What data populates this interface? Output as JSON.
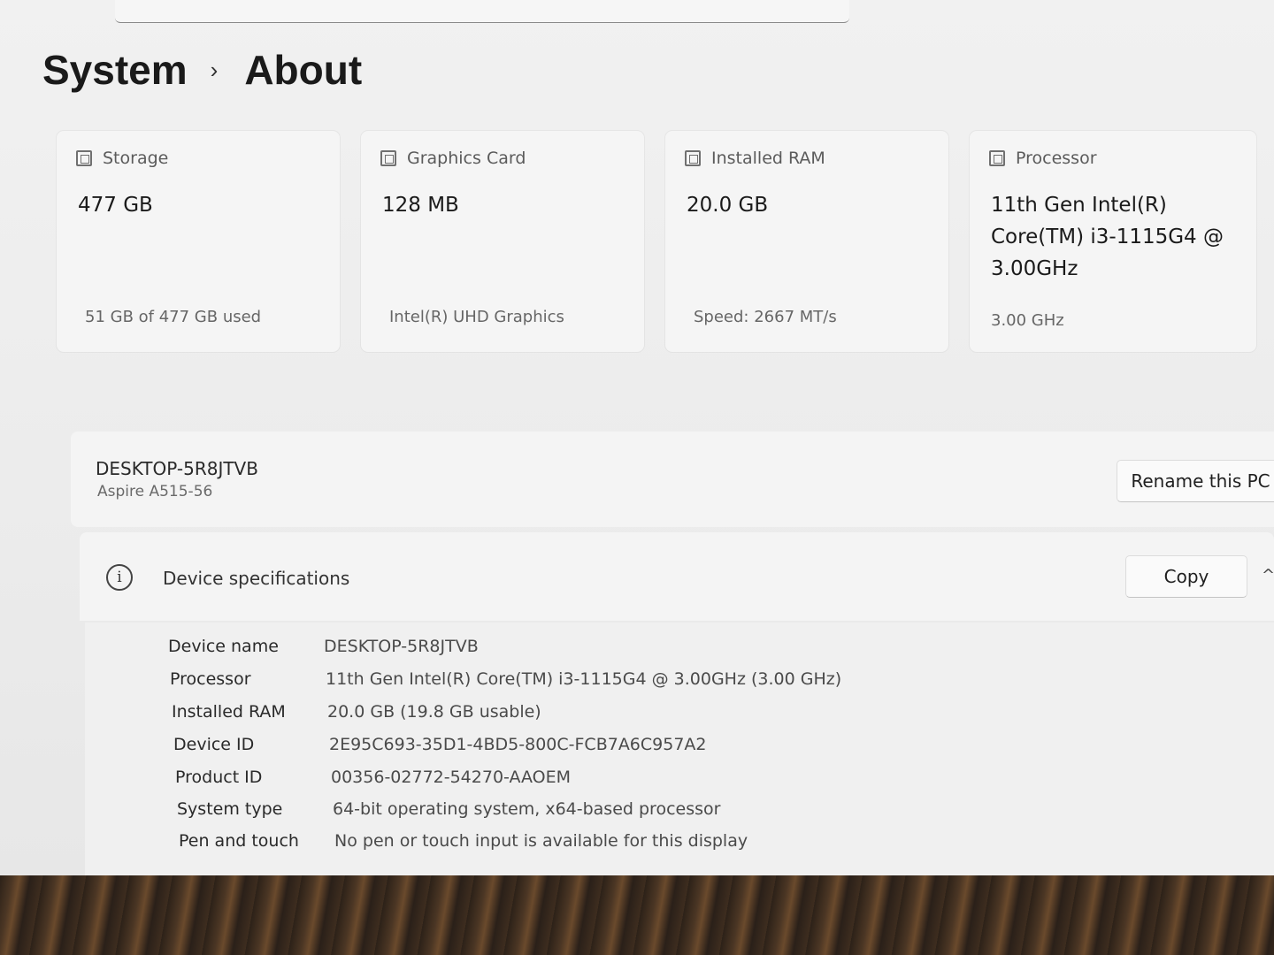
{
  "breadcrumb": {
    "parent": "System",
    "separator": "›",
    "current": "About"
  },
  "cards": [
    {
      "label": "Storage",
      "icon": "storage-icon",
      "value": "477 GB",
      "sub": "51 GB of 477 GB used"
    },
    {
      "label": "Graphics Card",
      "icon": "graphics-card-icon",
      "value": "128 MB",
      "sub": "Intel(R) UHD Graphics"
    },
    {
      "label": "Installed RAM",
      "icon": "ram-icon",
      "value": "20.0 GB",
      "sub": "Speed: 2667 MT/s"
    },
    {
      "label": "Processor",
      "icon": "processor-icon",
      "value": "11th Gen Intel(R) Core(TM) i3-1115G4 @ 3.00GHz",
      "sub": "3.00 GHz"
    }
  ],
  "pc": {
    "name": "DESKTOP-5R8JTVB",
    "model": "Aspire A515-56",
    "rename_label": "Rename this PC"
  },
  "specs": {
    "title": "Device specifications",
    "copy_label": "Copy",
    "rows": [
      {
        "key": "Device name",
        "value": "DESKTOP-5R8JTVB"
      },
      {
        "key": "Processor",
        "value": "11th Gen Intel(R) Core(TM) i3-1115G4 @ 3.00GHz (3.00 GHz)"
      },
      {
        "key": "Installed RAM",
        "value": "20.0 GB (19.8 GB usable)"
      },
      {
        "key": "Device ID",
        "value": "2E95C693-35D1-4BD5-800C-FCB7A6C957A2"
      },
      {
        "key": "Product ID",
        "value": "00356-02772-54270-AAOEM"
      },
      {
        "key": "System type",
        "value": "64-bit operating system, x64-based processor"
      },
      {
        "key": "Pen and touch",
        "value": "No pen or touch input is available for this display"
      }
    ]
  }
}
